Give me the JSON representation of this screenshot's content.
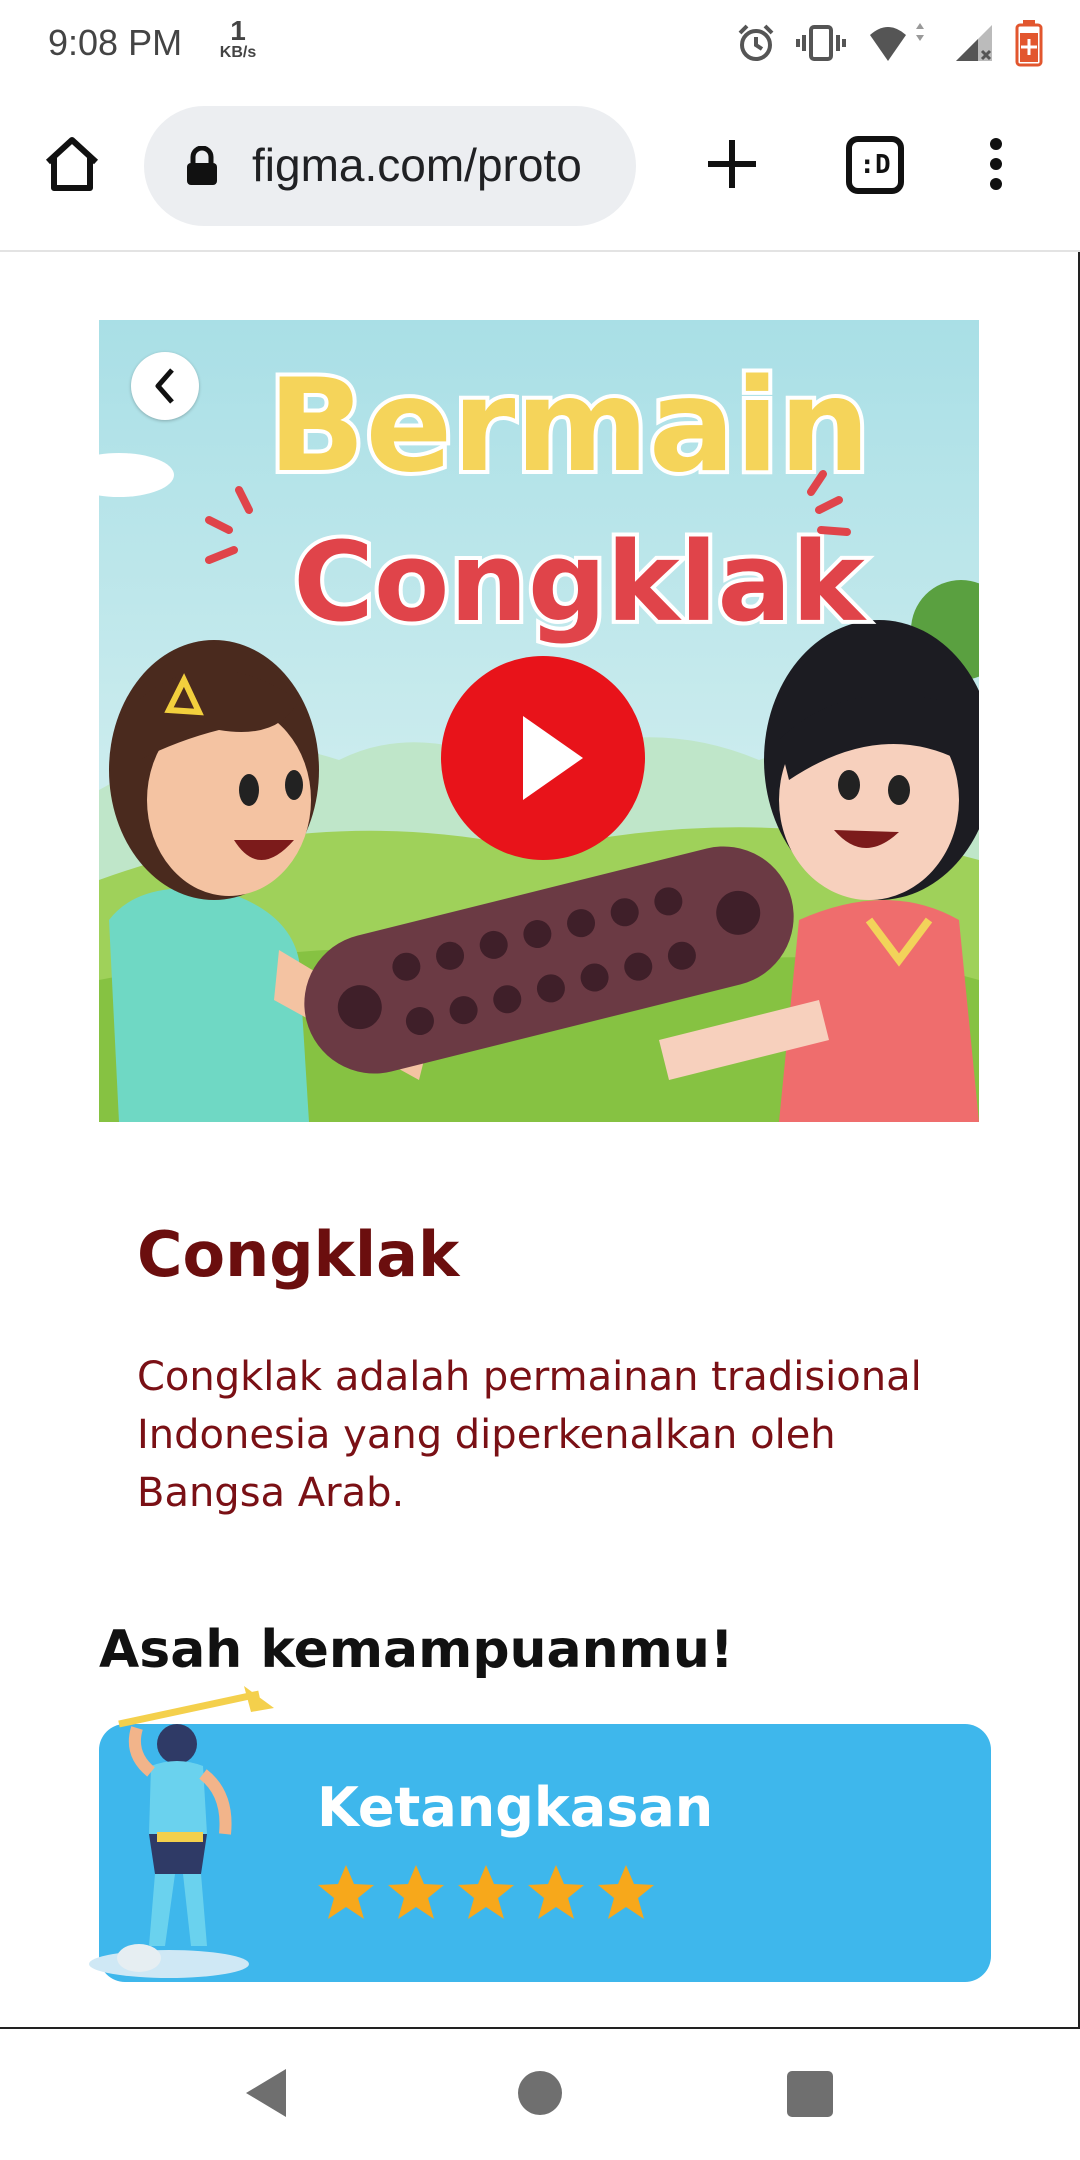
{
  "status_bar": {
    "time": "9:08 PM",
    "net_speed_value": "1",
    "net_speed_unit": "KB/s",
    "icons": [
      "alarm-icon",
      "vibrate-icon",
      "wifi-icon",
      "signal-icon",
      "battery-icon"
    ]
  },
  "browser": {
    "url": "figma.com/proto",
    "tab_count_label": ":D",
    "icons": [
      "home-icon",
      "lock-icon",
      "plus-icon",
      "more-vert-icon"
    ]
  },
  "hero": {
    "title_line1": "Bermain",
    "title_line2": "Congklak",
    "icons": [
      "back-icon",
      "play-icon"
    ]
  },
  "game": {
    "title": "Congklak",
    "description": "Congklak adalah permainan tradisional Indonesia yang diperkenalkan oleh Bangsa Arab."
  },
  "skills": {
    "heading": "Asah kemampuanmu!",
    "items": [
      {
        "name": "Ketangkasan",
        "rating": 5,
        "max_rating": 5
      }
    ]
  },
  "colors": {
    "title_text": "#6b0e0e",
    "skill_card": "#3eb7ec",
    "star": "#f7a81b",
    "play_button": "#e8131a"
  },
  "nav_bar": {
    "icons": [
      "nav-back-icon",
      "nav-home-icon",
      "nav-recents-icon"
    ]
  }
}
